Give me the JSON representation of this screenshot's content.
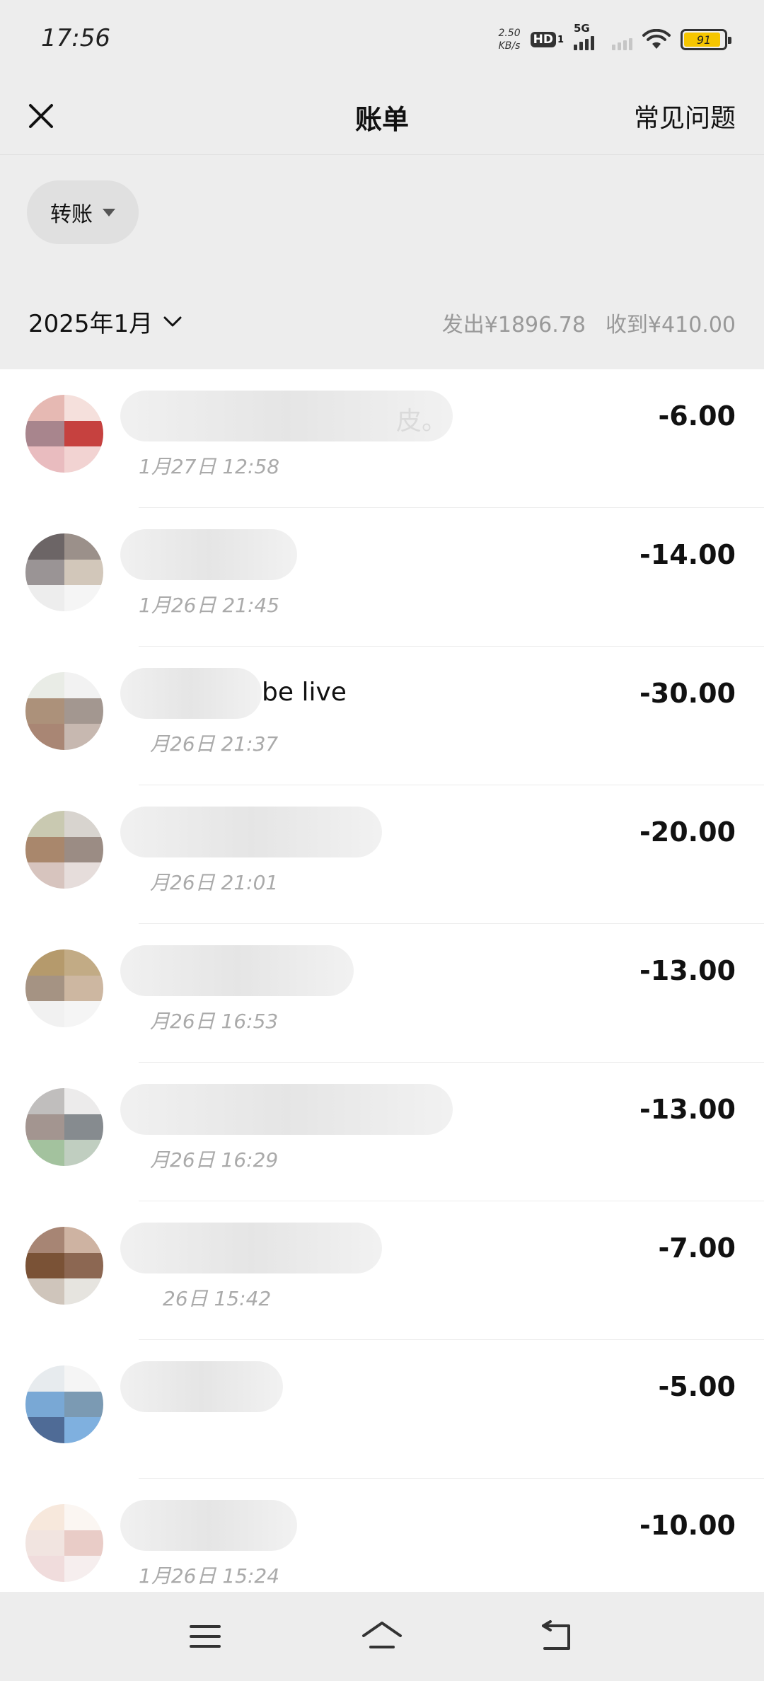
{
  "status_bar": {
    "time": "17:56",
    "net_speed_value": "2.50",
    "net_speed_unit": "KB/s",
    "hd_label": "HD",
    "hd_sub": "1",
    "network_label": "5G",
    "battery_level": "91",
    "battery_color": "#f6c600"
  },
  "header": {
    "close_icon": "close-icon",
    "title": "账单",
    "faq_label": "常见问题"
  },
  "filter": {
    "selected": "转账"
  },
  "summary": {
    "month": "2025年1月",
    "sent": "发出¥1896.78",
    "received": "收到¥410.00"
  },
  "transactions": [
    {
      "name": "皮。",
      "time": "1月27日  12:58",
      "amount": "-6.00"
    },
    {
      "name": "",
      "time": "1月26日  21:45",
      "amount": "-14.00"
    },
    {
      "name": "be live",
      "time": "月26日  21:37",
      "amount": "-30.00"
    },
    {
      "name": "",
      "time": "月26日  21:01",
      "amount": "-20.00"
    },
    {
      "name": "",
      "time": "月26日  16:53",
      "amount": "-13.00"
    },
    {
      "name": "",
      "time": "月26日  16:29",
      "amount": "-13.00"
    },
    {
      "name": "",
      "time": "26日  15:42",
      "amount": "-7.00"
    },
    {
      "name": "",
      "time": "",
      "amount": "-5.00"
    },
    {
      "name": "",
      "time": "1月26日  15:24",
      "amount": "-10.00"
    }
  ],
  "nav": {
    "menu_icon": "menu-icon",
    "home_icon": "home-icon",
    "back_icon": "back-icon"
  }
}
